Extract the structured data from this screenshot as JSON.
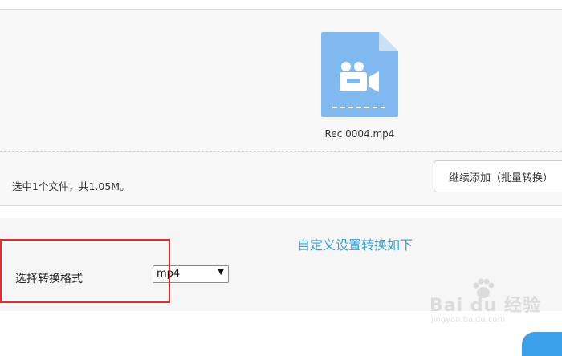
{
  "upload": {
    "file_name": "Rec 0004.mp4",
    "file_icon": "video-file-icon",
    "summary": "选中1个文件，共1.05M。",
    "add_more_label": "继续添加（批量转换）"
  },
  "settings": {
    "title": "自定义设置转换如下",
    "format_label": "选择转换格式",
    "format_value": "mp4",
    "format_arrow": "▼"
  },
  "watermark": {
    "text": "Bai du 经验",
    "url": "jingyan.baidu.com"
  },
  "colors": {
    "file_icon_bg": "#7fb9f0",
    "accent_blue": "#3aa0d8",
    "highlight_red": "#e82b2b"
  }
}
